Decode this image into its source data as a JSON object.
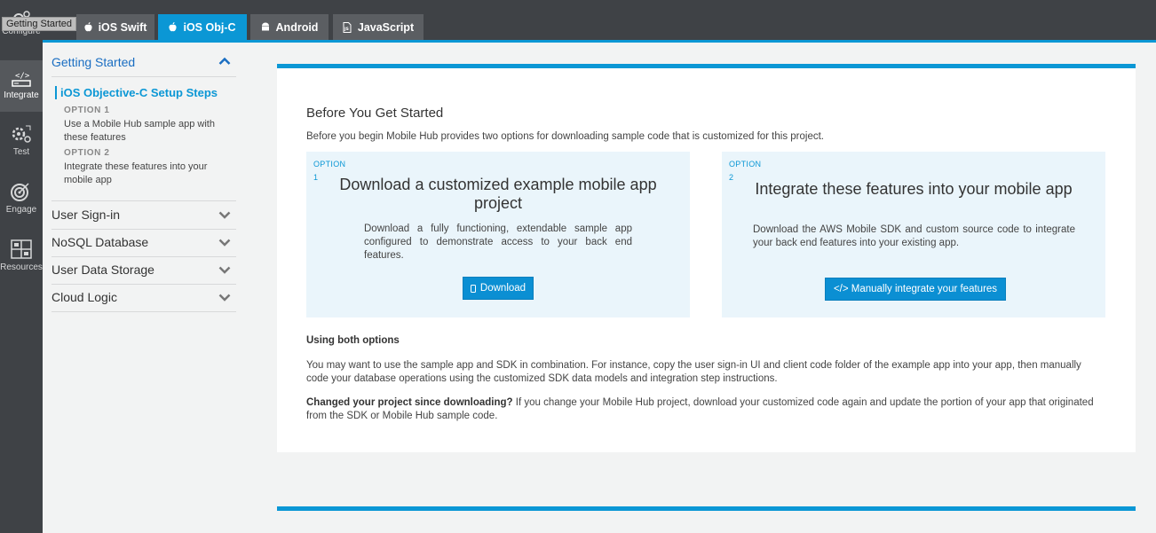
{
  "tooltip": "Getting Started",
  "rail": {
    "items": [
      {
        "label": "Configure",
        "icon": "gears-icon"
      },
      {
        "label": "Integrate",
        "icon": "code-device-icon"
      },
      {
        "label": "Test",
        "icon": "test-gears-icon"
      },
      {
        "label": "Engage",
        "icon": "target-icon"
      },
      {
        "label": "Resources",
        "icon": "grid-icon"
      }
    ]
  },
  "tabs": [
    {
      "label": "iOS Swift",
      "icon": "apple-icon"
    },
    {
      "label": "iOS Obj-C",
      "icon": "apple-icon"
    },
    {
      "label": "Android",
      "icon": "android-icon"
    },
    {
      "label": "JavaScript",
      "icon": "js-file-icon"
    }
  ],
  "nav": {
    "header": "Getting Started",
    "setup_title": "iOS Objective-C Setup Steps",
    "option1_label": "OPTION 1",
    "option1_text": "Use a Mobile Hub sample app with these features",
    "option2_label": "OPTION 2",
    "option2_text": "Integrate these features into your mobile app",
    "items": [
      "User Sign-in",
      "NoSQL Database",
      "User Data Storage",
      "Cloud Logic"
    ]
  },
  "main": {
    "title": "Before You Get Started",
    "subtitle": "Before you begin Mobile Hub provides two options for downloading sample code that is customized for this project.",
    "option1": {
      "label": "OPTION",
      "num": "1",
      "title": "Download a customized example mobile app project",
      "text": "Download a fully functioning, extendable sample app configured to demonstrate access to your back end features.",
      "button": "Download"
    },
    "option2": {
      "label": "OPTION",
      "num": "2",
      "title": "Integrate these features into your mobile app",
      "text": "Download the AWS Mobile SDK and custom source code to integrate your back end features into your existing app.",
      "button": "</> Manually integrate your features"
    },
    "both_title": "Using both options",
    "both_text": "You may want to use the sample app and SDK in combination. For instance, copy the user sign-in UI and client code folder of the example app into your app, then manually code your database operations using the customized SDK data models and integration step instructions.",
    "changed_bold": "Changed your project since downloading?",
    "changed_text": " If you change your Mobile Hub project, download your customized code again and update the portion of your app that originated from the SDK or Mobile Hub sample code."
  },
  "colors": {
    "accent": "#0b97d5",
    "rail": "#3f4246",
    "link": "#1a6ec2"
  }
}
